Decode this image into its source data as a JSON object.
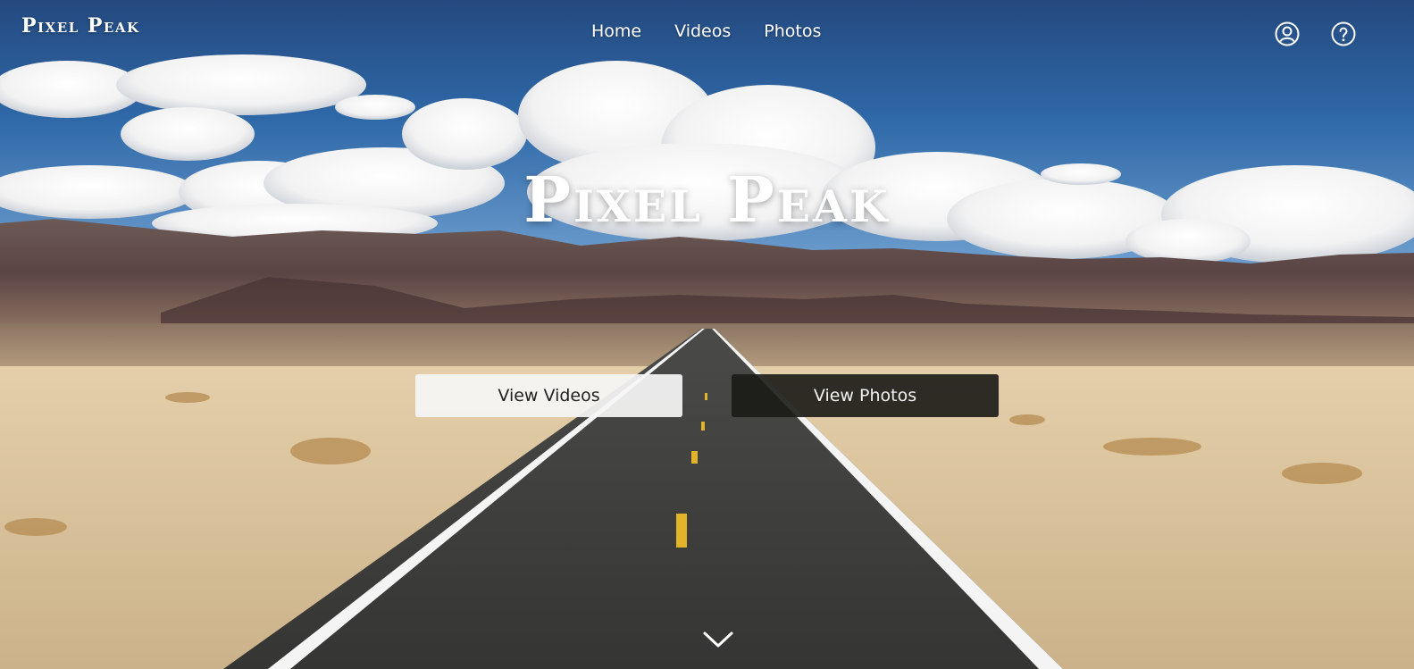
{
  "header": {
    "logo_text": "Pixel Peak",
    "nav_items": [
      {
        "label": "Home"
      },
      {
        "label": "Videos"
      },
      {
        "label": "Photos"
      }
    ],
    "icons": [
      "user-icon",
      "help-icon"
    ]
  },
  "hero": {
    "title": "Pixel Peak",
    "buttons": {
      "videos_label": "View Videos",
      "photos_label": "View Photos"
    },
    "scroll_icon": "chevron-down-icon"
  },
  "colors": {
    "sky": "#2a5a9a",
    "road": "#3a3a3a",
    "sand": "#d8c09a",
    "btn_light": "#f5f5f5",
    "btn_dark": "#191916"
  }
}
